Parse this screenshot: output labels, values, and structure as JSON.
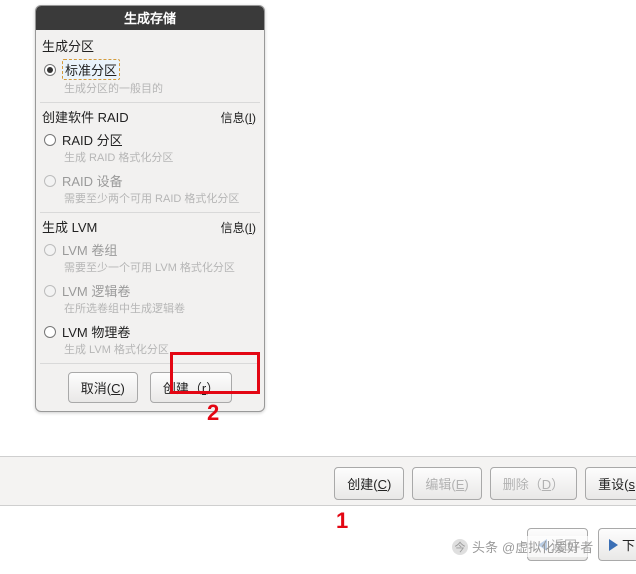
{
  "dialog": {
    "title": "生成存储",
    "section1": {
      "title": "生成分区"
    },
    "opt_std": {
      "label": "标准分区",
      "desc": "生成分区的一般目的"
    },
    "section2": {
      "title": "创建软件 RAID",
      "info": "信息",
      "info_u": "I"
    },
    "opt_raid_part": {
      "label": "RAID 分区",
      "desc": "生成 RAID 格式化分区"
    },
    "opt_raid_dev": {
      "label": "RAID 设备",
      "desc": "需要至少两个可用 RAID 格式化分区"
    },
    "section3": {
      "title": "生成 LVM",
      "info": "信息",
      "info_u": "I"
    },
    "opt_lvm_vg": {
      "label": "LVM 卷组",
      "desc": "需要至少一个可用 LVM 格式化分区"
    },
    "opt_lvm_lv": {
      "label": "LVM 逻辑卷",
      "desc": "在所选卷组中生成逻辑卷"
    },
    "opt_lvm_pv": {
      "label": "LVM 物理卷",
      "desc": "生成 LVM 格式化分区"
    },
    "cancel": {
      "pre": "取消(",
      "u": "C",
      "post": ")"
    },
    "create": {
      "pre": "创建（",
      "u": "r",
      "post": "）"
    }
  },
  "toolbar": {
    "create": {
      "pre": "创建(",
      "u": "C",
      "post": ")"
    },
    "edit": {
      "pre": "编辑(",
      "u": "E",
      "post": ")"
    },
    "delete": {
      "pre": "删除（",
      "u": "D",
      "post": "）"
    },
    "reset": {
      "pre": "重设(",
      "u": "s",
      "post": ""
    }
  },
  "nav": {
    "back": "返回",
    "next_frag": "下"
  },
  "markers": {
    "one": "1",
    "two": "2"
  },
  "watermark": {
    "t1": "头条",
    "t2": "@虚拟化爱好者"
  }
}
